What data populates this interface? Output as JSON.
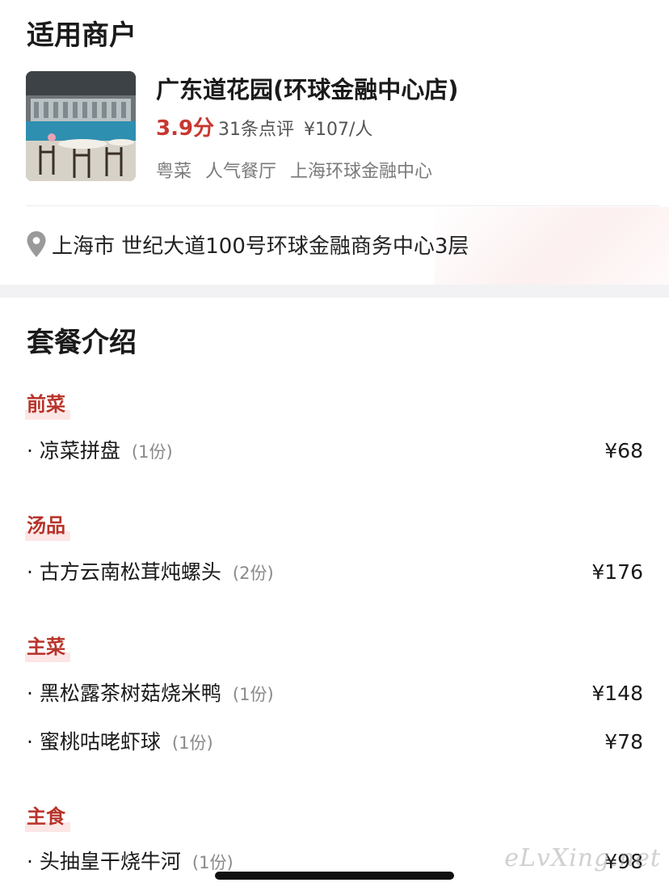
{
  "merchant_section": {
    "title": "适用商户",
    "store": {
      "name": "广东道花园(环球金融中心店)",
      "score": "3.9分",
      "reviews": "31条点评",
      "price_per_person": "¥107/人",
      "tags": [
        "粤菜",
        "人气餐厅",
        "上海环球金融中心"
      ],
      "address": "上海市 世纪大道100号环球金融商务中心3层"
    }
  },
  "package_section": {
    "title": "套餐介绍",
    "categories": [
      {
        "name": "前菜",
        "items": [
          {
            "name": "· 凉菜拼盘",
            "qty": "(1份)",
            "price": "¥68"
          }
        ]
      },
      {
        "name": "汤品",
        "items": [
          {
            "name": "· 古方云南松茸炖螺头",
            "qty": "(2份)",
            "price": "¥176"
          }
        ]
      },
      {
        "name": "主菜",
        "items": [
          {
            "name": "· 黑松露茶树菇烧米鸭",
            "qty": "(1份)",
            "price": "¥148"
          },
          {
            "name": "· 蜜桃咕咾虾球",
            "qty": "(1份)",
            "price": "¥78"
          }
        ]
      },
      {
        "name": "主食",
        "items": [
          {
            "name": "· 头抽皇干烧牛河",
            "qty": "(1份)",
            "price": "¥98"
          }
        ]
      }
    ]
  },
  "watermark": "eLvXing.net",
  "colors": {
    "accent_red": "#c7372f",
    "category_red": "#b8332a",
    "section_gap": "#f2f2f4"
  },
  "icons": {
    "location": "location-pin-icon"
  }
}
